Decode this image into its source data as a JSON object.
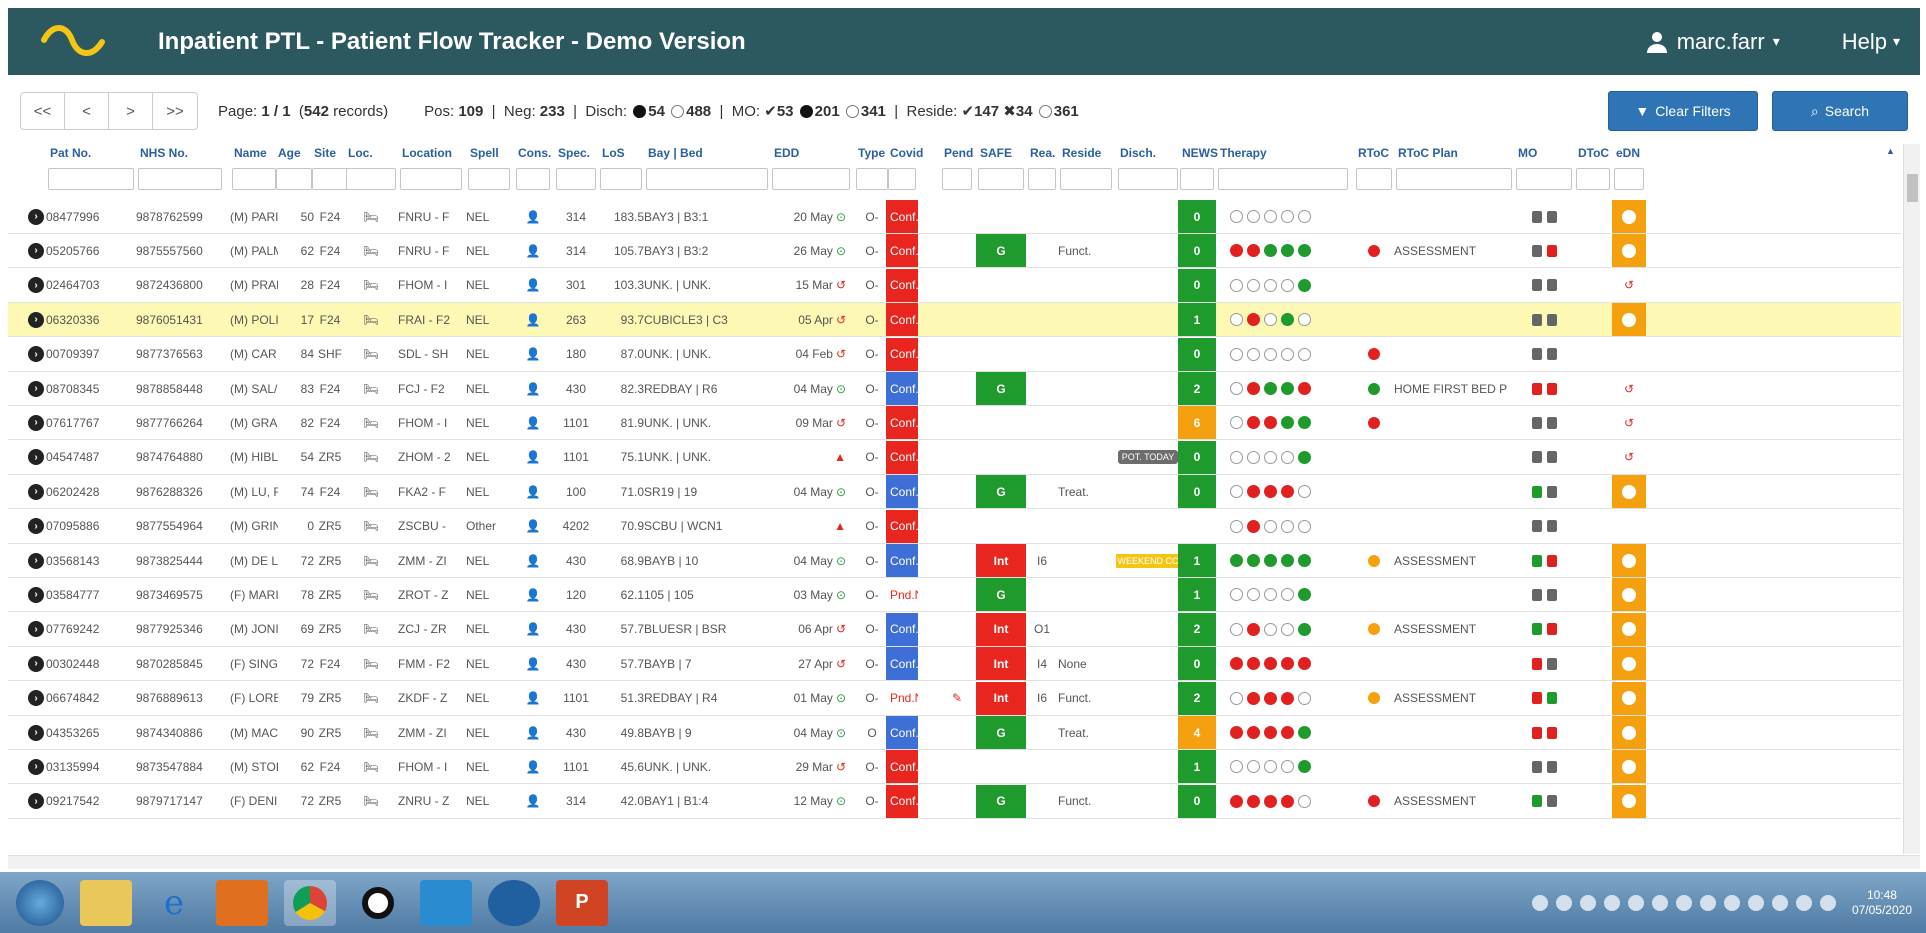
{
  "header": {
    "title": "Inpatient PTL - Patient Flow Tracker - Demo Version",
    "user": "marc.farr",
    "help": "Help"
  },
  "toolbar": {
    "pager": [
      "<<",
      "<",
      ">",
      ">>"
    ],
    "page_label": "Page:",
    "page_value": "1 / 1",
    "records_open": "(",
    "records_count": "542",
    "records_close": " records)",
    "pos_label": "Pos:",
    "pos_value": "109",
    "neg_label": "Neg:",
    "neg_value": "233",
    "disch_label": "Disch:",
    "disch_filled": "54",
    "disch_open": "488",
    "mo_label": "MO:",
    "mo_check": "53",
    "mo_filled": "201",
    "mo_open": "341",
    "reside_label": "Reside:",
    "reside_check": "147",
    "reside_x": "34",
    "reside_open": "361",
    "clear_filters": "Clear Filters",
    "search": "Search"
  },
  "columns": [
    "Pat No.",
    "NHS No.",
    "Name",
    "Age",
    "Site",
    "Loc.",
    "Location",
    "Spell",
    "Cons.",
    "Spec.",
    "LoS",
    "Bay | Bed",
    "EDD",
    "Type",
    "Covid",
    "Pend",
    "SAFE",
    "Rea.",
    "Reside",
    "Disch.",
    "NEWS",
    "Therapy",
    "RToC",
    "RToC Plan",
    "MO",
    "DToC",
    "eDN"
  ],
  "rows": [
    {
      "pat": "08477996",
      "nhs": "9878762599",
      "name": "(M) PARI",
      "age": "50",
      "site": "F24",
      "loc": "FNRU - F",
      "spell": "NEL",
      "spec": "314",
      "los": "183.5",
      "bay": "BAY3 | B3:1",
      "edd": "20 May",
      "edd_s": "ok",
      "type": "O-",
      "covid": "Conf.Neg",
      "cv": "red",
      "pend": "",
      "safe": "",
      "safe_c": "",
      "rea": "",
      "reside": "",
      "disch": "",
      "news": "0",
      "news_c": "#1f9a2c",
      "th": "ooooo",
      "rtoc": "",
      "plan": "",
      "mo": [
        "#666",
        "#666"
      ],
      "edn": "y"
    },
    {
      "pat": "05205766",
      "nhs": "9875557560",
      "name": "(M) PALM",
      "age": "62",
      "site": "F24",
      "loc": "FNRU - F",
      "spell": "NEL",
      "spec": "314",
      "los": "105.7",
      "bay": "BAY3 | B3:2",
      "edd": "26 May",
      "edd_s": "ok",
      "type": "O-",
      "covid": "Conf.Neg",
      "cv": "red",
      "pend": "",
      "safe": "G",
      "safe_c": "g",
      "rea": "",
      "reside": "Funct.",
      "disch": "",
      "news": "0",
      "news_c": "#1f9a2c",
      "th": "rrggg",
      "rtoc": "#e12020",
      "plan": "ASSESSMENT",
      "mo": [
        "#666",
        "#e12020"
      ],
      "edn": "y"
    },
    {
      "pat": "02464703",
      "nhs": "9872436800",
      "name": "(M) PRAI",
      "age": "28",
      "site": "F24",
      "loc": "FHOM - I",
      "spell": "NEL",
      "spec": "301",
      "los": "103.3",
      "bay": "UNK. | UNK.",
      "edd": "15 Mar",
      "edd_s": "warn",
      "type": "O-",
      "covid": "Conf.Neg",
      "cv": "red",
      "pend": "",
      "safe": "",
      "safe_c": "",
      "rea": "",
      "reside": "",
      "disch": "",
      "news": "0",
      "news_c": "#1f9a2c",
      "th": "ooooг",
      "rtoc": "",
      "plan": "",
      "mo": [
        "#666",
        "#666"
      ],
      "edn": "u"
    },
    {
      "pat": "06320336",
      "nhs": "9876051431",
      "name": "(M) POLI",
      "age": "17",
      "site": "F24",
      "loc": "FRAI - F2",
      "spell": "NEL",
      "spec": "263",
      "los": "93.7",
      "bay": "CUBICLE3 | C3",
      "edd": "05 Apr",
      "edd_s": "warn",
      "type": "O-",
      "covid": "Conf.Neg",
      "cv": "red",
      "pend": "",
      "safe": "",
      "safe_c": "",
      "rea": "",
      "reside": "",
      "disch": "",
      "news": "1",
      "news_c": "#1f9a2c",
      "th": "oroгo",
      "rtoc": "",
      "plan": "",
      "mo": [
        "#666",
        "#666"
      ],
      "edn": "y",
      "hl": true
    },
    {
      "pat": "00709397",
      "nhs": "9877376563",
      "name": "(M) CAR",
      "age": "84",
      "site": "SHF",
      "loc": "SDL - SH",
      "spell": "NEL",
      "spec": "180",
      "los": "87.0",
      "bay": "UNK. | UNK.",
      "edd": "04 Feb",
      "edd_s": "warn",
      "type": "O-",
      "covid": "Conf.Neg",
      "cv": "red",
      "pend": "",
      "safe": "",
      "safe_c": "",
      "rea": "",
      "reside": "",
      "disch": "",
      "news": "0",
      "news_c": "#1f9a2c",
      "th": "ooooo",
      "rtoc": "#e12020",
      "plan": "",
      "mo": [
        "#666",
        "#666"
      ],
      "edn": ""
    },
    {
      "pat": "08708345",
      "nhs": "9878858448",
      "name": "(M) SAL/",
      "age": "83",
      "site": "F24",
      "loc": "FCJ - F2",
      "spell": "NEL",
      "spec": "430",
      "los": "82.3",
      "bay": "REDBAY | R6",
      "edd": "04 May",
      "edd_s": "ok",
      "type": "O-",
      "covid": "Conf.Pos",
      "cv": "blue",
      "pend": "",
      "safe": "G",
      "safe_c": "g",
      "rea": "",
      "reside": "",
      "disch": "",
      "news": "2",
      "news_c": "#1f9a2c",
      "th": "orggr",
      "rtoc": "#1f9a2c",
      "plan": "HOME FIRST BED P",
      "mo": [
        "#e12020",
        "#e12020"
      ],
      "edn": "u"
    },
    {
      "pat": "07617767",
      "nhs": "9877766264",
      "name": "(M) GRA",
      "age": "82",
      "site": "F24",
      "loc": "FHOM - I",
      "spell": "NEL",
      "spec": "1101",
      "los": "81.9",
      "bay": "UNK. | UNK.",
      "edd": "09 Mar",
      "edd_s": "warn",
      "type": "O-",
      "covid": "Conf.Neg",
      "cv": "red",
      "pend": "",
      "safe": "",
      "safe_c": "",
      "rea": "",
      "reside": "",
      "disch": "",
      "news": "6",
      "news_c": "#f5a00f",
      "th": "orrgg",
      "rtoc": "#e12020",
      "plan": "",
      "mo": [
        "#666",
        "#666"
      ],
      "edn": "u"
    },
    {
      "pat": "04547487",
      "nhs": "9874764880",
      "name": "(M) HIBL",
      "age": "54",
      "site": "ZR5",
      "loc": "ZHOM - 2",
      "spell": "NEL",
      "spec": "1101",
      "los": "75.1",
      "bay": "UNK. | UNK.",
      "edd": "",
      "edd_s": "alert",
      "type": "O-",
      "covid": "Conf.Neg",
      "cv": "red",
      "pend": "",
      "safe": "",
      "safe_c": "",
      "rea": "",
      "reside": "",
      "disch": "POT. TODAY",
      "news": "0",
      "news_c": "#1f9a2c",
      "th": "ooooг",
      "rtoc": "",
      "plan": "",
      "mo": [
        "#666",
        "#666"
      ],
      "edn": "u"
    },
    {
      "pat": "06202428",
      "nhs": "9876288326",
      "name": "(M) LU, F",
      "age": "74",
      "site": "F24",
      "loc": "FKA2 - F",
      "spell": "NEL",
      "spec": "100",
      "los": "71.0",
      "bay": "SR19 | 19",
      "edd": "04 May",
      "edd_s": "ok",
      "type": "O-",
      "covid": "Conf.Pos",
      "cv": "blue",
      "pend": "",
      "safe": "G",
      "safe_c": "g",
      "rea": "",
      "reside": "Treat.",
      "disch": "",
      "news": "0",
      "news_c": "#1f9a2c",
      "th": "orrro",
      "rtoc": "",
      "plan": "",
      "mo": [
        "#1f9a2c",
        "#666"
      ],
      "edn": "y"
    },
    {
      "pat": "07095886",
      "nhs": "9877554964",
      "name": "(M) GRIN",
      "age": "0",
      "site": "ZR5",
      "loc": "ZSCBU -",
      "spell": "Other",
      "spec": "4202",
      "los": "70.9",
      "bay": "SCBU | WCN1",
      "edd": "",
      "edd_s": "alert",
      "type": "O-",
      "covid": "Conf.Neg",
      "cv": "red",
      "pend": "",
      "safe": "",
      "safe_c": "",
      "rea": "",
      "reside": "",
      "disch": "",
      "news": "",
      "news_c": "",
      "th": "orooo",
      "rtoc": "",
      "plan": "",
      "mo": [
        "#666",
        "#666"
      ],
      "edn": ""
    },
    {
      "pat": "03568143",
      "nhs": "9873825444",
      "name": "(M) DE L",
      "age": "72",
      "site": "ZR5",
      "loc": "ZMM - ZI",
      "spell": "NEL",
      "spec": "430",
      "los": "68.9",
      "bay": "BAYB | 10",
      "edd": "04 May",
      "edd_s": "ok",
      "type": "O-",
      "covid": "Conf.Pos",
      "cv": "blue",
      "pend": "",
      "safe": "Int",
      "safe_c": "r",
      "rea": "I6",
      "reside": "",
      "disch": "WEEKEND CC",
      "news": "1",
      "news_c": "#1f9a2c",
      "th": "ggggg",
      "rtoc": "#f5a00f",
      "plan": "ASSESSMENT",
      "mo": [
        "#1f9a2c",
        "#e12020"
      ],
      "edn": "y"
    },
    {
      "pat": "03584777",
      "nhs": "9873469575",
      "name": "(F) MARI",
      "age": "78",
      "site": "ZR5",
      "loc": "ZROT - Z",
      "spell": "NEL",
      "spec": "120",
      "los": "62.1",
      "bay": "105 | 105",
      "edd": "03 May",
      "edd_s": "ok",
      "type": "O-",
      "covid": "Pnd.NtSp",
      "cv": "pnd",
      "pend": "",
      "safe": "G",
      "safe_c": "g",
      "rea": "",
      "reside": "",
      "disch": "",
      "news": "1",
      "news_c": "#1f9a2c",
      "th": "ooooг",
      "rtoc": "",
      "plan": "",
      "mo": [
        "#666",
        "#666"
      ],
      "edn": "y"
    },
    {
      "pat": "07769242",
      "nhs": "9877925346",
      "name": "(M) JONI",
      "age": "69",
      "site": "ZR5",
      "loc": "ZCJ - ZR",
      "spell": "NEL",
      "spec": "430",
      "los": "57.7",
      "bay": "BLUESR | BSR",
      "edd": "06 Apr",
      "edd_s": "warn",
      "type": "O-",
      "covid": "Conf.Pos",
      "cv": "blue",
      "pend": "",
      "safe": "Int",
      "safe_c": "r",
      "rea": "O1",
      "reside": "",
      "disch": "",
      "news": "2",
      "news_c": "#1f9a2c",
      "th": "orooг",
      "rtoc": "#f5a00f",
      "plan": "ASSESSMENT",
      "mo": [
        "#1f9a2c",
        "#e12020"
      ],
      "edn": "y"
    },
    {
      "pat": "00302448",
      "nhs": "9870285845",
      "name": "(F) SING",
      "age": "72",
      "site": "F24",
      "loc": "FMM - F2",
      "spell": "NEL",
      "spec": "430",
      "los": "57.7",
      "bay": "BAYB | 7",
      "edd": "27 Apr",
      "edd_s": "warn",
      "type": "O-",
      "covid": "Conf.Pos",
      "cv": "blue",
      "pend": "",
      "safe": "Int",
      "safe_c": "r",
      "rea": "I4",
      "reside": "None",
      "disch": "",
      "news": "0",
      "news_c": "#1f9a2c",
      "th": "rrrrr",
      "rtoc": "",
      "plan": "",
      "mo": [
        "#e12020",
        "#666"
      ],
      "edn": "y"
    },
    {
      "pat": "06674842",
      "nhs": "9876889613",
      "name": "(F) LORE",
      "age": "79",
      "site": "ZR5",
      "loc": "ZKDF - Z",
      "spell": "NEL",
      "spec": "1101",
      "los": "51.3",
      "bay": "REDBAY | R4",
      "edd": "01 May",
      "edd_s": "ok",
      "type": "O-",
      "covid": "Pnd.NtSp",
      "cv": "pnd",
      "pend": "p",
      "safe": "Int",
      "safe_c": "r",
      "rea": "I6",
      "reside": "Funct.",
      "disch": "",
      "news": "2",
      "news_c": "#1f9a2c",
      "th": "orrro",
      "rtoc": "#f5a00f",
      "plan": "ASSESSMENT",
      "mo": [
        "#e12020",
        "#1f9a2c"
      ],
      "edn": "y"
    },
    {
      "pat": "04353265",
      "nhs": "9874340886",
      "name": "(M) MAC",
      "age": "90",
      "site": "ZR5",
      "loc": "ZMM - ZI",
      "spell": "NEL",
      "spec": "430",
      "los": "49.8",
      "bay": "BAYB | 9",
      "edd": "04 May",
      "edd_s": "ok",
      "type": "O",
      "covid": "Conf.Pos",
      "cv": "blue",
      "pend": "",
      "safe": "G",
      "safe_c": "g",
      "rea": "",
      "reside": "Treat.",
      "disch": "",
      "news": "4",
      "news_c": "#f5a00f",
      "th": "rrrrг",
      "rtoc": "",
      "plan": "",
      "mo": [
        "#e12020",
        "#e12020"
      ],
      "edn": "y"
    },
    {
      "pat": "03135994",
      "nhs": "9873547884",
      "name": "(M) STOI",
      "age": "62",
      "site": "F24",
      "loc": "FHOM - I",
      "spell": "NEL",
      "spec": "1101",
      "los": "45.6",
      "bay": "UNK. | UNK.",
      "edd": "29 Mar",
      "edd_s": "warn",
      "type": "O-",
      "covid": "Conf.Neg",
      "cv": "red",
      "pend": "",
      "safe": "",
      "safe_c": "",
      "rea": "",
      "reside": "",
      "disch": "",
      "news": "1",
      "news_c": "#1f9a2c",
      "th": "ooooг",
      "rtoc": "",
      "plan": "",
      "mo": [
        "#666",
        "#666"
      ],
      "edn": "y"
    },
    {
      "pat": "09217542",
      "nhs": "9879717147",
      "name": "(F) DENI",
      "age": "72",
      "site": "ZR5",
      "loc": "ZNRU - Z",
      "spell": "NEL",
      "spec": "314",
      "los": "42.0",
      "bay": "BAY1 | B1:4",
      "edd": "12 May",
      "edd_s": "ok",
      "type": "O-",
      "covid": "Conf.Neg",
      "cv": "red",
      "pend": "",
      "safe": "G",
      "safe_c": "g",
      "rea": "",
      "reside": "Funct.",
      "disch": "",
      "news": "0",
      "news_c": "#1f9a2c",
      "th": "rrrro",
      "rtoc": "#e12020",
      "plan": "ASSESSMENT",
      "mo": [
        "#1f9a2c",
        "#666"
      ],
      "edn": "y"
    }
  ],
  "taskbar": {
    "time": "10:48",
    "date": "07/05/2020"
  }
}
